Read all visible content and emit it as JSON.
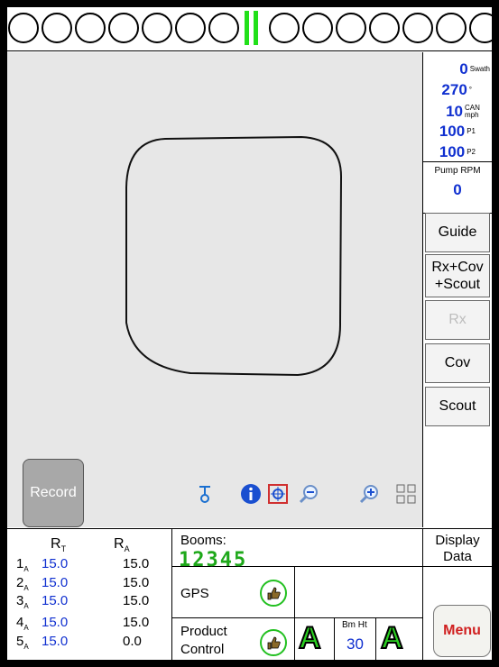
{
  "led_bar": {
    "left_count": 7,
    "right_count": 7,
    "center_color": "#22e01a"
  },
  "map": {
    "record_label": "Record"
  },
  "readouts": [
    {
      "value": "0",
      "unit": "Swath"
    },
    {
      "value": "270",
      "unit": "°"
    },
    {
      "value": "10",
      "unit": "CAN mph"
    },
    {
      "value": "100",
      "unit": "P1"
    },
    {
      "value": "100",
      "unit": "P2"
    }
  ],
  "pump": {
    "label": "Pump RPM",
    "value": "0"
  },
  "side_buttons": [
    {
      "label": "Guide",
      "enabled": true
    },
    {
      "label": "Rx+Cov +Scout",
      "enabled": true
    },
    {
      "label": "Rx",
      "enabled": false
    },
    {
      "label": "Cov",
      "enabled": true
    },
    {
      "label": "Scout",
      "enabled": true
    }
  ],
  "toolbar_icons": [
    "boom-pointer-icon",
    "info-icon",
    "center-target-icon",
    "zoom-out-icon",
    "zoom-in-icon",
    "fit-extent-icon"
  ],
  "rates": {
    "header_t": "R",
    "header_t_sub": "T",
    "header_a": "R",
    "header_a_sub": "A",
    "rows": [
      {
        "idx": "1",
        "sub": "A",
        "rt": "15.0",
        "ra": "15.0"
      },
      {
        "idx": "2",
        "sub": "A",
        "rt": "15.0",
        "ra": "15.0"
      },
      {
        "idx": "3",
        "sub": "A",
        "rt": "15.0",
        "ra": "15.0"
      },
      {
        "idx": "4",
        "sub": "A",
        "rt": "15.0",
        "ra": "15.0"
      },
      {
        "idx": "5",
        "sub": "A",
        "rt": "15.0",
        "ra": "0.0"
      }
    ]
  },
  "booms": {
    "label": "Booms:",
    "numbers": "12345"
  },
  "gps": {
    "label": "GPS"
  },
  "product_control": {
    "label_line1": "Product",
    "label_line2": "Control",
    "mode": "A"
  },
  "boom_height": {
    "label": "Bm Ht",
    "value": "30",
    "mode": "A"
  },
  "display_data": {
    "line1": "Display",
    "line2": "Data"
  },
  "menu": {
    "label": "Menu"
  },
  "colors": {
    "value_blue": "#1030d0",
    "ok_green": "#22c020",
    "menu_red": "#d02020"
  }
}
